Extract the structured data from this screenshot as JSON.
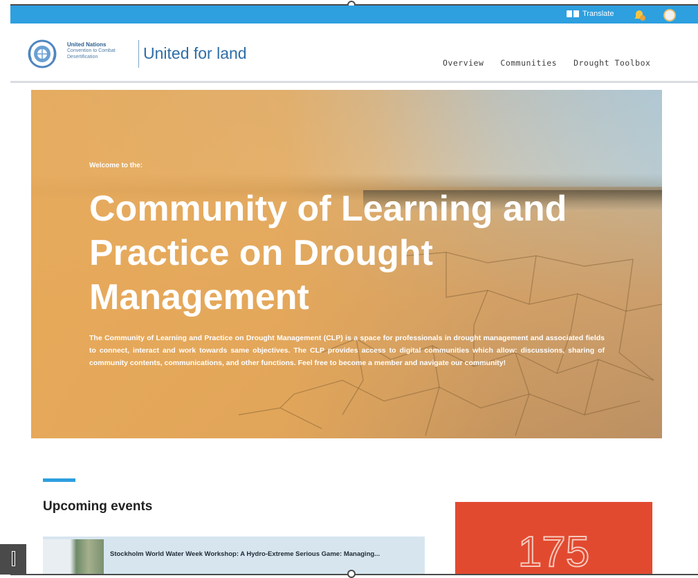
{
  "topbar": {
    "translate_label": "Translate",
    "icons": [
      "translate-icon",
      "notification-icon",
      "avatar"
    ]
  },
  "header": {
    "org_name_line1": "United Nations",
    "org_name_line2": "Convention to Combat",
    "org_name_line3": "Desertification",
    "brand": "United for land",
    "nav": [
      {
        "label": "Overview"
      },
      {
        "label": "Communities"
      },
      {
        "label": "Drought Toolbox"
      }
    ]
  },
  "hero": {
    "welcome": "Welcome to the:",
    "title": "Community of Learning and Practice on Drought Management",
    "description": "The Community of Learning and Practice on Drought Management (CLP) is a space for professionals in drought management and associated fields to connect, interact and work towards same objectives. The CLP provides access to digital communities which allow: discussions, sharing of community contents, communications, and other functions. Feel free to become a member and navigate our community!"
  },
  "events": {
    "section_title": "Upcoming events",
    "items": [
      {
        "title": "Stockholm World Water Week Workshop: A Hydro-Extreme Serious Game: Managing..."
      }
    ]
  },
  "stats": {
    "number": "175"
  },
  "colors": {
    "topbar": "#2e9fdf",
    "brand": "#2f6ea6",
    "stat_card": "#e24a30",
    "event_card": "#d7e5ef"
  }
}
